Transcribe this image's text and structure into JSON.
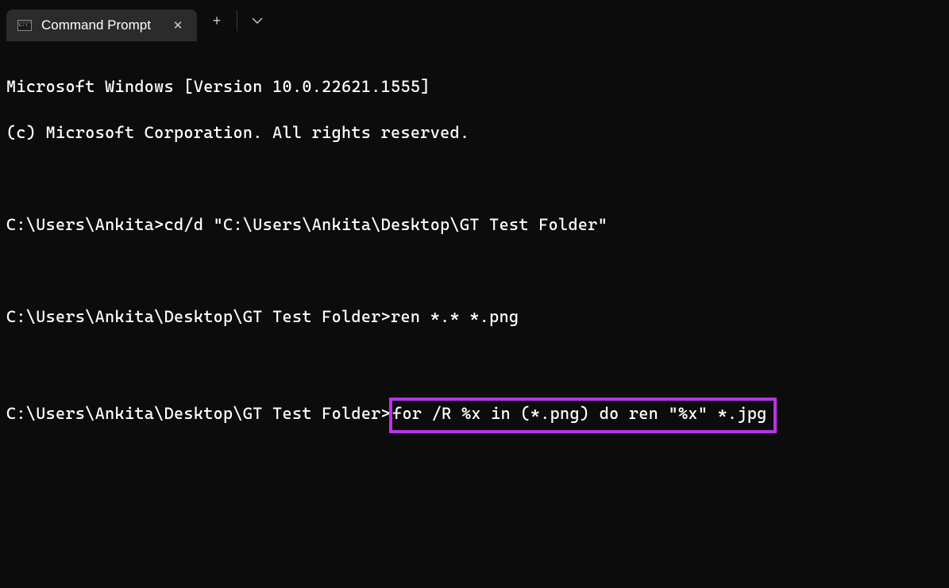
{
  "titlebar": {
    "tab_title": "Command Prompt",
    "new_tab_label": "+",
    "dropdown_label": "⌄",
    "close_label": "✕"
  },
  "terminal": {
    "line1": "Microsoft Windows [Version 10.0.22621.1555]",
    "line2": "(c) Microsoft Corporation. All rights reserved.",
    "blank1": " ",
    "prompt1": "C:\\Users\\Ankita>",
    "cmd1": "cd/d \"C:\\Users\\Ankita\\Desktop\\GT Test Folder\"",
    "blank2": " ",
    "prompt2": "C:\\Users\\Ankita\\Desktop\\GT Test Folder>",
    "cmd2": "ren *.* *.png",
    "blank3": " ",
    "prompt3": "C:\\Users\\Ankita\\Desktop\\GT Test Folder>",
    "cmd3": "for /R %x in (*.png) do ren \"%x\" *.jpg"
  }
}
